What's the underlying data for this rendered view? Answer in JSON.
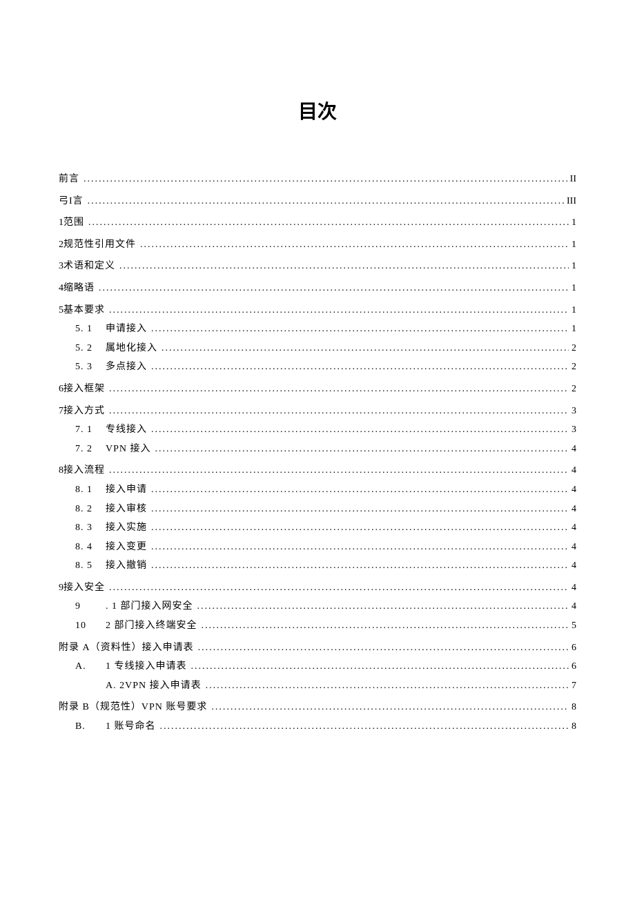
{
  "title": "目次",
  "toc": [
    {
      "level": 0,
      "num": "",
      "label": "前言",
      "page": "II"
    },
    {
      "level": 0,
      "num": "",
      "label": "弓I言",
      "page": "III"
    },
    {
      "level": 0,
      "num": "1",
      "label": "范围",
      "page": "1"
    },
    {
      "level": 0,
      "num": "2",
      "label": "规范性引用文件",
      "page": "1"
    },
    {
      "level": 0,
      "num": "3",
      "label": "术语和定义",
      "page": "1"
    },
    {
      "level": 0,
      "num": "4",
      "label": "缩略语",
      "page": "1"
    },
    {
      "level": 0,
      "num": "5",
      "label": "基本要求",
      "page": "1"
    },
    {
      "level": 1,
      "num": "5. 1",
      "label": "申请接入",
      "page": "1"
    },
    {
      "level": 1,
      "num": "5. 2",
      "label": "属地化接入",
      "page": "2"
    },
    {
      "level": 1,
      "num": "5. 3",
      "label": "多点接入",
      "page": "2"
    },
    {
      "level": 0,
      "num": "6",
      "label": "接入框架",
      "page": "2"
    },
    {
      "level": 0,
      "num": "7",
      "label": "接入方式",
      "page": "3"
    },
    {
      "level": 1,
      "num": "7. 1",
      "label": "专线接入",
      "page": "3"
    },
    {
      "level": 1,
      "num": "7. 2",
      "label": "VPN 接入",
      "page": "4"
    },
    {
      "level": 0,
      "num": "8",
      "label": "接入流程",
      "page": "4"
    },
    {
      "level": 1,
      "num": "8. 1",
      "label": "接入申请",
      "page": "4"
    },
    {
      "level": 1,
      "num": "8. 2",
      "label": "接入审核",
      "page": "4"
    },
    {
      "level": 1,
      "num": "8. 3",
      "label": "接入实施",
      "page": "4"
    },
    {
      "level": 1,
      "num": "8. 4",
      "label": "接入变更",
      "page": "4"
    },
    {
      "level": 1,
      "num": "8. 5",
      "label": "接入撤销",
      "page": "4"
    },
    {
      "level": 0,
      "num": "9",
      "label": "接入安全",
      "page": "4"
    },
    {
      "level": 1,
      "num": "9",
      "label": ". 1 部门接入网安全",
      "page": "4"
    },
    {
      "level": 1,
      "num": "10",
      "label": "2 部门接入终端安全",
      "page": "5"
    },
    {
      "level": 0,
      "num": "",
      "label": "附录 A（资料性）接入申请表",
      "page": "6"
    },
    {
      "level": 1,
      "num": "A.",
      "label": "1 专线接入申请表",
      "page": "6"
    },
    {
      "level": 1,
      "num": "",
      "label": "A. 2VPN 接入申请表",
      "page": "7"
    },
    {
      "level": 0,
      "num": "",
      "label": "附录 B（规范性）VPN 账号要求",
      "page": "8"
    },
    {
      "level": 1,
      "num": "B.",
      "label": "1 账号命名",
      "page": "8"
    }
  ]
}
